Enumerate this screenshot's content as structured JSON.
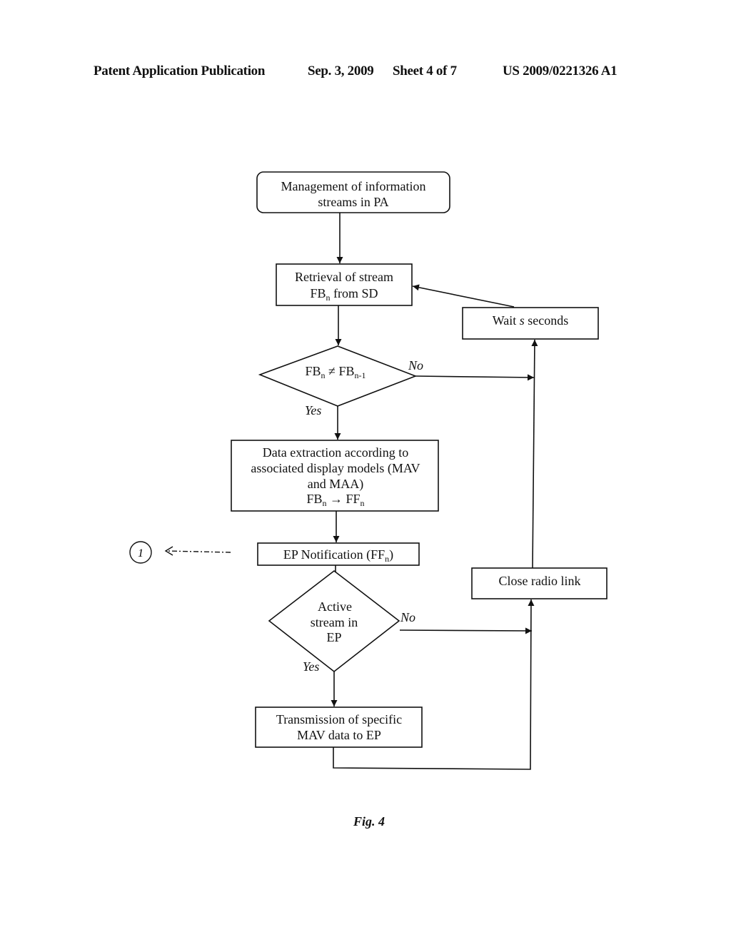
{
  "header": {
    "publication": "Patent Application Publication",
    "date": "Sep. 3, 2009",
    "sheet": "Sheet 4 of 7",
    "number": "US 2009/0221326 A1"
  },
  "figure": {
    "caption": "Fig. 4",
    "nodes": {
      "start": [
        "Management of information",
        "streams in PA"
      ],
      "retrieval": {
        "line1": "Retrieval of stream",
        "line2_main": "FB",
        "line2_sub": "n",
        "line2_rest": " from SD"
      },
      "decision1": {
        "a": "FB",
        "a_sub": "n",
        "op": " ≠ ",
        "b": "FB",
        "b_sub": "n-1"
      },
      "extraction": {
        "lines": [
          "Data extraction according to",
          "associated display models (MAV",
          "and MAA)"
        ],
        "formula_a": "FB",
        "formula_a_sub": "n",
        "arrow": " → ",
        "formula_b": "FF",
        "formula_b_sub": "n"
      },
      "notification": {
        "main": "EP Notification (FF",
        "sub": "n",
        "end": ")"
      },
      "decision2": [
        "Active",
        "stream in",
        "EP"
      ],
      "transmission": [
        "Transmission of specific",
        "MAV data to EP"
      ],
      "wait": {
        "pre": "Wait ",
        "var": "s",
        "post": " seconds"
      },
      "close": "Close radio link",
      "connector": "1"
    },
    "edge_labels": {
      "d1_no": "No",
      "d1_yes": "Yes",
      "d2_no": "No",
      "d2_yes": "Yes"
    }
  }
}
